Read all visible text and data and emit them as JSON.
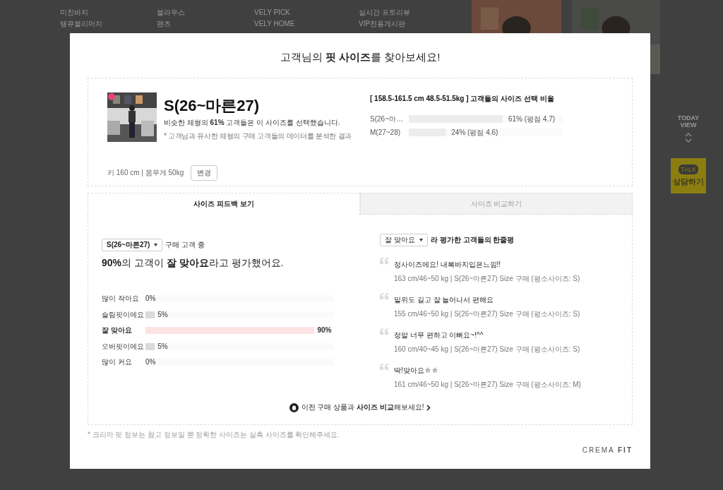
{
  "background": {
    "nav_columns": [
      [
        "미친바지",
        "땡큐블리머치"
      ],
      [
        "블라우스",
        "팬츠"
      ],
      [
        "VELY PICK",
        "VELY HOME"
      ],
      [
        "실시간 포토리뷰",
        "VIP전용게시판"
      ]
    ],
    "today_view": "TODAY VIEW",
    "talk": {
      "badge": "TALK",
      "label": "상담하기"
    }
  },
  "modal": {
    "title": "고객님의 **핏 사이즈**를 찾아보세요!",
    "recommendation": {
      "size": "S(26~마른27)",
      "summary": "비슷한 체형의 **61%** 고객들은 이 사이즈를 선택했습니다.",
      "note": "* 고객님과 유사한 체형의 구매 고객들의 데이터를 분석한 결과",
      "body": "키 160 cm | 몸무게 50kg",
      "change_button": "변경"
    },
    "distribution": {
      "title": "[ 158.5-161.5 cm 48.5-51.5kg ] 고객들의 사이즈 선택 비율",
      "rows": [
        {
          "label": "S(26~마…",
          "level": 0.61,
          "reading": "61% (평점 4.7)"
        },
        {
          "label": "M(27~28)",
          "level": 0.24,
          "reading": "24% (평점 4.6)"
        }
      ]
    },
    "tabs": [
      {
        "label": "사이즈 피드백 보기",
        "selected": true
      },
      {
        "label": "사이즈 비교하기",
        "selected": false
      }
    ],
    "feedback": {
      "size_select": "S(26~마른27)",
      "suffix": "구매 고객 중",
      "headline": "**90%**의 고객이 **잘 맞아요**라고 평가했어요.",
      "rows": [
        {
          "label": "많이 작아요",
          "level": 0,
          "reading": "0%",
          "selected": false
        },
        {
          "label": "슬림핏이에요",
          "level": 0.05,
          "reading": "5%",
          "selected": false
        },
        {
          "label": "잘 맞아요",
          "level": 0.9,
          "reading": "90%",
          "selected": true
        },
        {
          "label": "오버핏이에요",
          "level": 0.05,
          "reading": "5%",
          "selected": false
        },
        {
          "label": "많이 커요",
          "level": 0,
          "reading": "0%",
          "selected": false
        }
      ]
    },
    "reviews": {
      "filter": "잘 맞아요",
      "suffix": "라 평가한 고객들의 한줄평",
      "items": [
        {
          "text": "정사이즈에요! 내복바지입은느낌!!",
          "meta": "163 cm/46~50 kg | S(26~마른27) Size 구매 (평소사이즈: S)"
        },
        {
          "text": "밑위도 길고 잘 늘어나서 편해요",
          "meta": "155 cm/46~50 kg | S(26~마른27) Size 구매 (평소사이즈: S)"
        },
        {
          "text": "정말 너무 편하고 이뻐요~!^^",
          "meta": "160 cm/40~45 kg | S(26~마른27) Size 구매 (평소사이즈: S)"
        },
        {
          "text": "딱!맞아요ㅎㅎ",
          "meta": "161 cm/46~50 kg | S(26~마른27) Size 구매 (평소사이즈: M)"
        }
      ]
    },
    "compare_link": "이전 구매 상품과 **사이즈 비교**해보세요!",
    "footnote": "* 크리마 핏 정보는 참고 정보일 뿐 정확한 사이즈는 실측 사이즈를 확인해주세요.",
    "brand": "CREMA **FIT**"
  }
}
